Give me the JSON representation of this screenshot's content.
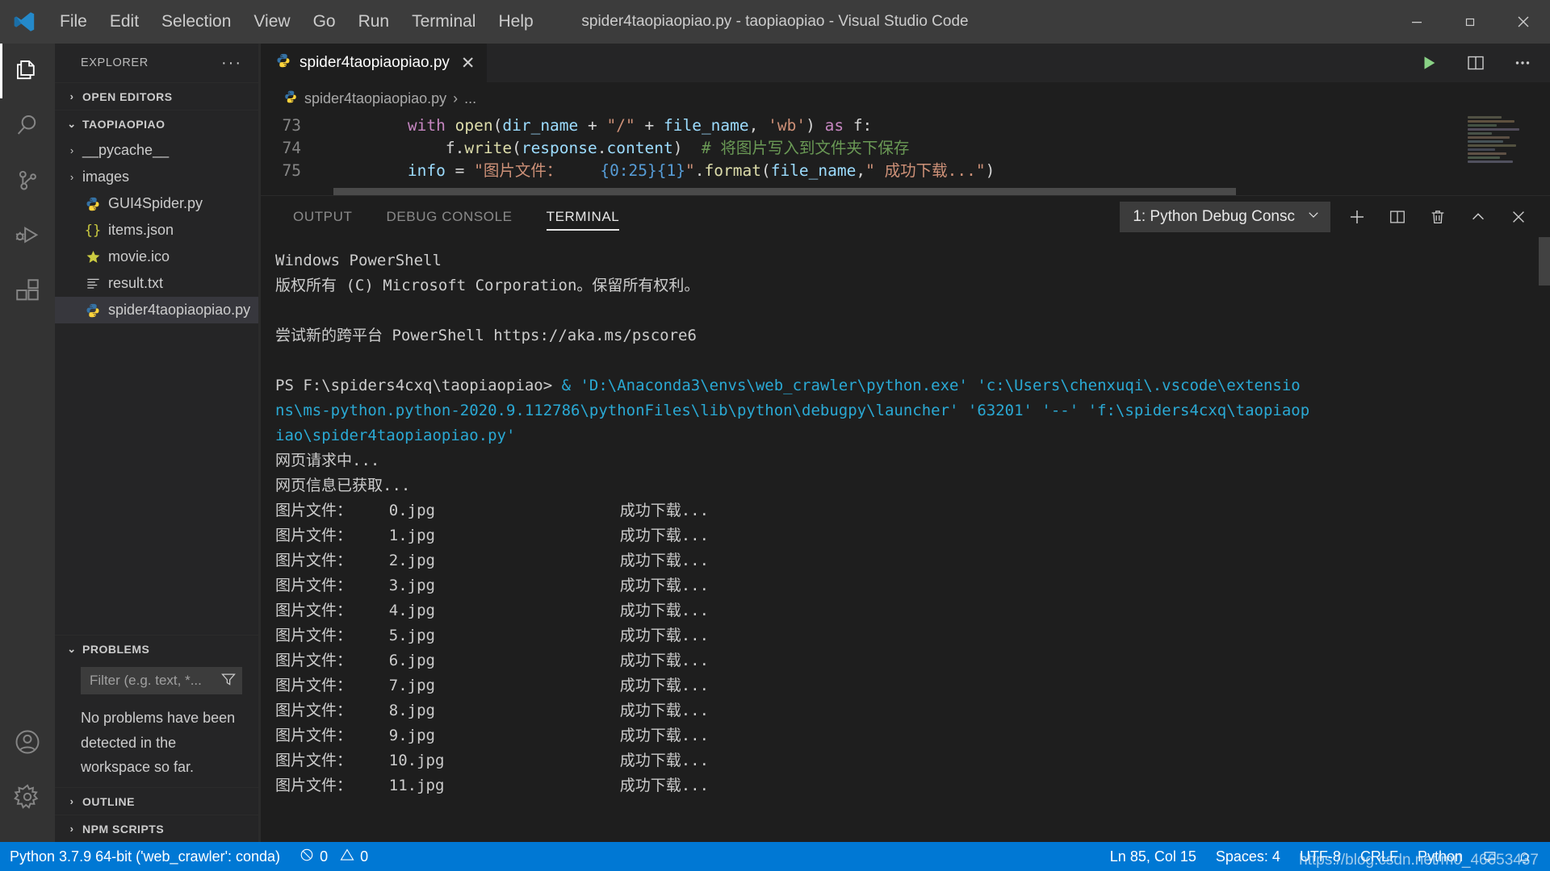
{
  "window": {
    "title": "spider4taopiaopiao.py - taopiaopiao - Visual Studio Code",
    "minimize_label": "─",
    "maximize_label": "❐",
    "close_label": "✕"
  },
  "menubar": {
    "items": [
      "File",
      "Edit",
      "Selection",
      "View",
      "Go",
      "Run",
      "Terminal",
      "Help"
    ]
  },
  "activitybar": {
    "items": [
      {
        "name": "explorer-icon",
        "label": "Explorer"
      },
      {
        "name": "search-icon",
        "label": "Search"
      },
      {
        "name": "source-control-icon",
        "label": "Source Control"
      },
      {
        "name": "run-debug-icon",
        "label": "Run and Debug"
      },
      {
        "name": "extensions-icon",
        "label": "Extensions"
      },
      {
        "name": "account-icon",
        "label": "Accounts"
      },
      {
        "name": "gear-icon",
        "label": "Manage"
      }
    ]
  },
  "sidebar": {
    "title": "EXPLORER",
    "more_actions": "···",
    "open_editors": {
      "label": "OPEN EDITORS",
      "expanded": false,
      "chevron": "›"
    },
    "folder": {
      "label": "TAOPIAOPIAO",
      "expanded": true,
      "chevron": "⌄"
    },
    "files": [
      {
        "label": "__pycache__",
        "type": "folder",
        "icon": "folder-icon",
        "chevron": "›",
        "selected": false
      },
      {
        "label": "images",
        "type": "folder",
        "icon": "folder-icon",
        "chevron": "›",
        "selected": false
      },
      {
        "label": "GUI4Spider.py",
        "type": "file",
        "icon": "python-icon",
        "selected": false
      },
      {
        "label": "items.json",
        "type": "file",
        "icon": "json-icon",
        "selected": false
      },
      {
        "label": "movie.ico",
        "type": "file",
        "icon": "star-icon",
        "selected": false
      },
      {
        "label": "result.txt",
        "type": "file",
        "icon": "text-icon",
        "selected": false
      },
      {
        "label": "spider4taopiaopiao.py",
        "type": "file",
        "icon": "python-icon",
        "selected": true
      }
    ],
    "problems": {
      "label": "PROBLEMS",
      "expanded": true,
      "chevron": "⌄",
      "filter_placeholder": "Filter (e.g. text, *...",
      "empty_message": "No problems have been detected in the workspace so far."
    },
    "outline": {
      "label": "OUTLINE",
      "chevron": "›"
    },
    "npm_scripts": {
      "label": "NPM SCRIPTS",
      "chevron": "›"
    }
  },
  "editor": {
    "tab": {
      "label": "spider4taopiaopiao.py",
      "icon": "python-icon",
      "close": "✕"
    },
    "actions": [
      {
        "name": "run-python-file-button",
        "glyph": "▶"
      },
      {
        "name": "split-editor-button",
        "glyph": "◫"
      },
      {
        "name": "more-actions-button",
        "glyph": "···"
      }
    ],
    "breadcrumb": {
      "file": "spider4taopiaopiao.py",
      "separator": "›",
      "rest": "..."
    },
    "lines": [
      {
        "number": "73",
        "tokens": [
          {
            "t": "plain",
            "v": "        "
          },
          {
            "t": "kw",
            "v": "with"
          },
          {
            "t": "plain",
            "v": " "
          },
          {
            "t": "fn",
            "v": "open"
          },
          {
            "t": "plain",
            "v": "("
          },
          {
            "t": "var",
            "v": "dir_name"
          },
          {
            "t": "plain",
            "v": " + "
          },
          {
            "t": "str",
            "v": "\"/\""
          },
          {
            "t": "plain",
            "v": " + "
          },
          {
            "t": "var",
            "v": "file_name"
          },
          {
            "t": "plain",
            "v": ", "
          },
          {
            "t": "str",
            "v": "'wb'"
          },
          {
            "t": "plain",
            "v": ") "
          },
          {
            "t": "kw",
            "v": "as"
          },
          {
            "t": "plain",
            "v": " f:"
          }
        ]
      },
      {
        "number": "74",
        "tokens": [
          {
            "t": "plain",
            "v": "            f."
          },
          {
            "t": "fn",
            "v": "write"
          },
          {
            "t": "plain",
            "v": "("
          },
          {
            "t": "var",
            "v": "response"
          },
          {
            "t": "plain",
            "v": "."
          },
          {
            "t": "var",
            "v": "content"
          },
          {
            "t": "plain",
            "v": ")  "
          },
          {
            "t": "cmt",
            "v": "# 将图片写入到文件夹下保存"
          }
        ]
      },
      {
        "number": "75",
        "tokens": [
          {
            "t": "plain",
            "v": "        "
          },
          {
            "t": "var",
            "v": "info"
          },
          {
            "t": "plain",
            "v": " = "
          },
          {
            "t": "str",
            "v": "\"图片文件：    "
          },
          {
            "t": "brace",
            "v": "{0:25}{1}"
          },
          {
            "t": "str",
            "v": "\""
          },
          {
            "t": "plain",
            "v": "."
          },
          {
            "t": "fn",
            "v": "format"
          },
          {
            "t": "plain",
            "v": "("
          },
          {
            "t": "var",
            "v": "file_name"
          },
          {
            "t": "plain",
            "v": ","
          },
          {
            "t": "str",
            "v": "\" 成功下载...\""
          },
          {
            "t": "plain",
            "v": ")"
          }
        ]
      }
    ]
  },
  "panel": {
    "tabs": [
      {
        "label": "OUTPUT",
        "active": false
      },
      {
        "label": "DEBUG CONSOLE",
        "active": false
      },
      {
        "label": "TERMINAL",
        "active": true
      }
    ],
    "terminal_select": {
      "value": "1: Python Debug Consc",
      "chevron": "⌄"
    },
    "actions": [
      {
        "name": "new-terminal-button",
        "glyph": "＋"
      },
      {
        "name": "split-terminal-button",
        "glyph": "◫"
      },
      {
        "name": "kill-terminal-button",
        "glyph": "Ὕ1"
      },
      {
        "name": "maximize-panel-button",
        "glyph": "⌃"
      },
      {
        "name": "close-panel-button",
        "glyph": "✕"
      }
    ],
    "terminal_lines": [
      {
        "color": "white",
        "text": "Windows PowerShell"
      },
      {
        "color": "white",
        "text": "版权所有 (C) Microsoft Corporation。保留所有权利。"
      },
      {
        "color": "white",
        "text": ""
      },
      {
        "color": "white",
        "text": "尝试新的跨平台 PowerShell https://aka.ms/pscore6"
      },
      {
        "color": "white",
        "text": ""
      },
      {
        "color": "mixed",
        "prompt": "PS F:\\spiders4cxq\\taopiaopiao>",
        "text": " & 'D:\\Anaconda3\\envs\\web_crawler\\python.exe' 'c:\\Users\\chenxuqi\\.vscode\\extensio"
      },
      {
        "color": "blue",
        "text": "ns\\ms-python.python-2020.9.112786\\pythonFiles\\lib\\python\\debugpy\\launcher' '63201' '--' 'f:\\spiders4cxq\\taopiaop"
      },
      {
        "color": "blue",
        "text": "iao\\spider4taopiaopiao.py'"
      },
      {
        "color": "white",
        "text": "网页请求中..."
      },
      {
        "color": "white",
        "text": "网页信息已获取..."
      },
      {
        "color": "white",
        "text": "图片文件：    0.jpg                    成功下载..."
      },
      {
        "color": "white",
        "text": "图片文件：    1.jpg                    成功下载..."
      },
      {
        "color": "white",
        "text": "图片文件：    2.jpg                    成功下载..."
      },
      {
        "color": "white",
        "text": "图片文件：    3.jpg                    成功下载..."
      },
      {
        "color": "white",
        "text": "图片文件：    4.jpg                    成功下载..."
      },
      {
        "color": "white",
        "text": "图片文件：    5.jpg                    成功下载..."
      },
      {
        "color": "white",
        "text": "图片文件：    6.jpg                    成功下载..."
      },
      {
        "color": "white",
        "text": "图片文件：    7.jpg                    成功下载..."
      },
      {
        "color": "white",
        "text": "图片文件：    8.jpg                    成功下载..."
      },
      {
        "color": "white",
        "text": "图片文件：    9.jpg                    成功下载..."
      },
      {
        "color": "white",
        "text": "图片文件：    10.jpg                   成功下载..."
      },
      {
        "color": "white",
        "text": "图片文件：    11.jpg                   成功下载..."
      }
    ]
  },
  "statusbar": {
    "interpreter": "Python 3.7.9 64-bit ('web_crawler': conda)",
    "errors": "0",
    "warnings": "0",
    "error_glyph": "⊗",
    "warning_glyph": "⚠",
    "cursor": "Ln 85, Col 15",
    "indentation": "Spaces: 4",
    "encoding": "UTF-8",
    "eol": "CRLF",
    "language": "Python",
    "bell_glyph": "ὑ4",
    "feedback_glyph": "☺",
    "watermark": "https://blog.csdn.net/m0_46653437"
  },
  "colors": {
    "accent": "#0078d4",
    "titlebar": "#3c3c3c",
    "activitybar": "#333333",
    "sidebar": "#252526",
    "editor": "#1e1e1e",
    "terminal_blue": "#2aa9d4"
  }
}
